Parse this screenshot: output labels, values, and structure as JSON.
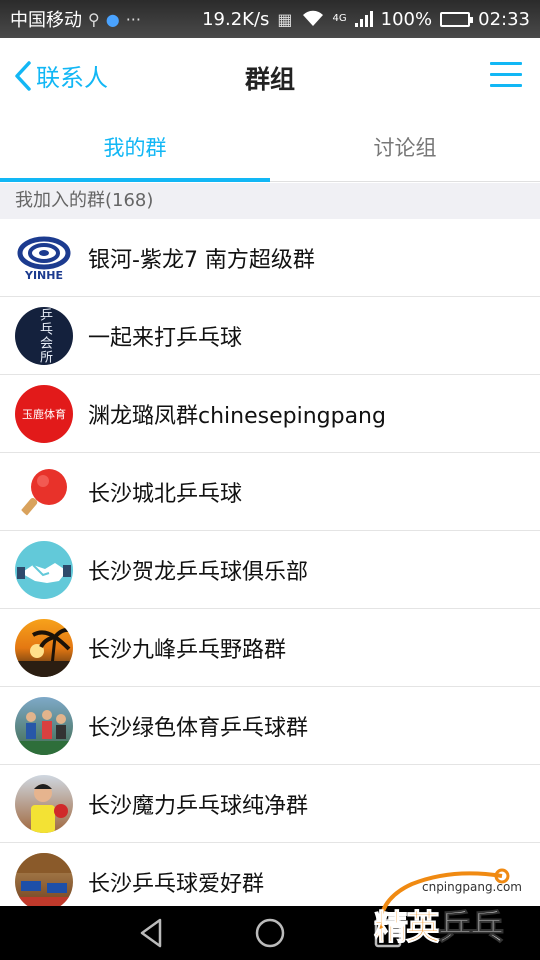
{
  "status_bar": {
    "carrier": "中国移动",
    "speed": "19.2K/s",
    "network": "4G",
    "battery": "100%",
    "time": "02:33",
    "icons": [
      "search-icon",
      "app-icon",
      "more-icon",
      "vibrate-icon",
      "wifi-icon",
      "signal-icon",
      "battery-icon"
    ]
  },
  "header": {
    "back_label": "联系人",
    "title": "群组",
    "accent": "#12b7f5"
  },
  "tabs": [
    {
      "label": "我的群",
      "active": true
    },
    {
      "label": "讨论组",
      "active": false
    }
  ],
  "section": {
    "title": "我加入的群(168)"
  },
  "groups": [
    {
      "name": "银河-紫龙7 南方超级群",
      "avatar": "yinhe-logo",
      "avatar_text": "YINHE"
    },
    {
      "name": "一起来打乒乓球",
      "avatar": "pingpong-club-sign",
      "avatar_text": "乒乓会所"
    },
    {
      "name": "渊龙璐凤群chinesepingpang",
      "avatar": "red-sports-logo",
      "avatar_text": "玉鹿体育"
    },
    {
      "name": "长沙城北乒乓球",
      "avatar": "paddle-icon"
    },
    {
      "name": "长沙贺龙乒乓球俱乐部",
      "avatar": "handshake-icon"
    },
    {
      "name": "长沙九峰乒乓野路群",
      "avatar": "sunset-palm-photo"
    },
    {
      "name": "长沙绿色体育乒乓球群",
      "avatar": "players-photo"
    },
    {
      "name": "长沙魔力乒乓球纯净群",
      "avatar": "player-photo"
    },
    {
      "name": "长沙乒乓球爱好群",
      "avatar": "hall-photo"
    }
  ],
  "nav": {
    "buttons": [
      "back-icon",
      "home-icon",
      "recent-apps-icon"
    ]
  },
  "watermark": {
    "url": "cnpingpang.com",
    "text_orange": "精英",
    "text_white": "乒乓网"
  }
}
